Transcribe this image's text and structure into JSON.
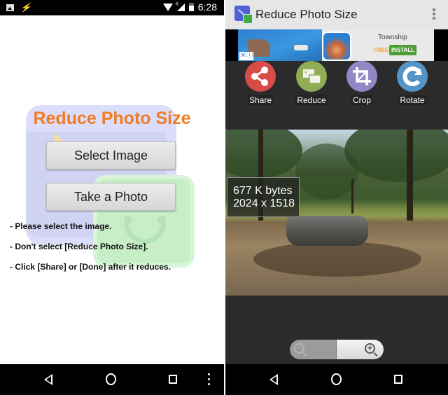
{
  "left": {
    "status_bar": {
      "time": "6:28",
      "left_icons": [
        "image-notification-icon",
        "flash-icon"
      ],
      "right_icons": [
        "wifi-icon",
        "signal-roaming-icon",
        "battery-icon"
      ],
      "roaming_label": "R"
    },
    "app_title": "Reduce Photo Size",
    "buttons": {
      "select_image": "Select Image",
      "take_photo": "Take a Photo"
    },
    "hints": [
      "- Please select the image.",
      "- Don't select [Reduce Photo Size].",
      "- Click [Share] or [Done] after it reduces."
    ],
    "nav": [
      "back",
      "home",
      "recents",
      "more"
    ]
  },
  "right": {
    "action_bar": {
      "title": "Reduce Photo Size",
      "menu_icon": "overflow-menu-icon"
    },
    "ad": {
      "app_name": "Township",
      "price": "FREE",
      "cta": "INSTALL",
      "adchoices": "✕ⓘ"
    },
    "tools": [
      {
        "label": "Share",
        "icon": "share-icon",
        "color": "#d84c47"
      },
      {
        "label": "Reduce",
        "icon": "reduce-icon",
        "color": "#8ead56"
      },
      {
        "label": "Crop",
        "icon": "crop-icon",
        "color": "#9387c6"
      },
      {
        "label": "Rotate",
        "icon": "rotate-icon",
        "color": "#5594c6"
      }
    ],
    "photo_info": {
      "size": "677 K bytes",
      "dimensions": "2024 x 1518"
    },
    "zoom": {
      "out": "−",
      "in": "+"
    },
    "nav": [
      "back",
      "home",
      "recents"
    ]
  },
  "colors": {
    "title_orange": "#ef7c22",
    "install_green": "#4c9e34",
    "free_orange": "#f0a23a"
  }
}
